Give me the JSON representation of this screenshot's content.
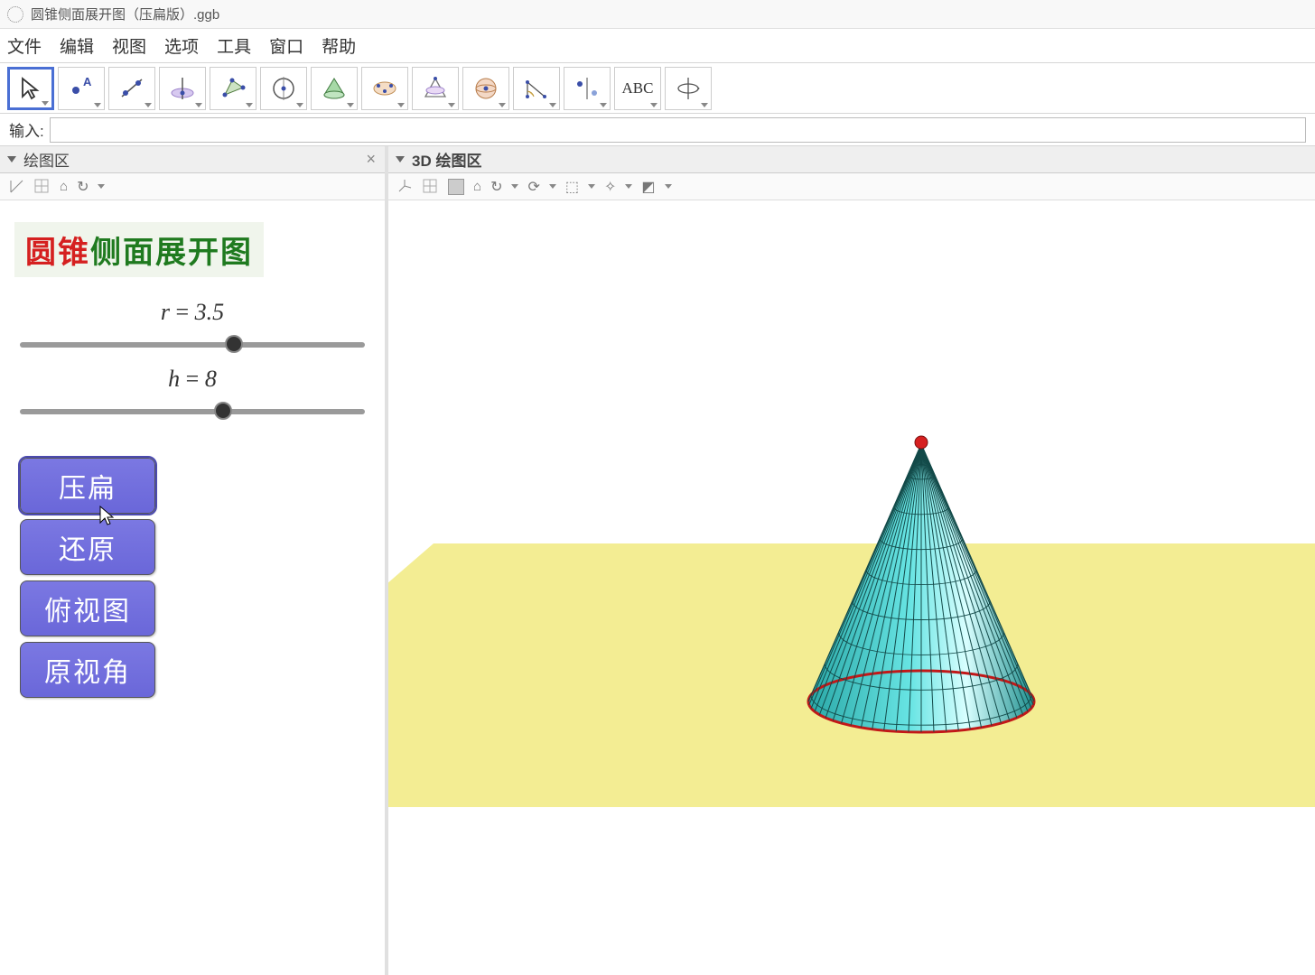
{
  "window": {
    "title": "圆锥侧面展开图（压扁版）.ggb"
  },
  "menu": {
    "file": "文件",
    "edit": "编辑",
    "view": "视图",
    "options": "选项",
    "tools": "工具",
    "window": "窗口",
    "help": "帮助"
  },
  "toolbar": {
    "move": "move-tool",
    "point": "point-tool",
    "line": "line-tool",
    "perp": "perpendicular-tool",
    "polygon": "polygon-tool",
    "circle": "circle-tool",
    "conic": "conic-tool",
    "locus": "locus-tool",
    "angle": "angle-tool",
    "sphere": "sphere-tool",
    "reflect": "reflect-tool",
    "slider": "slider-tool",
    "text": "text-tool",
    "rotate3d": "rotate3d-tool",
    "text_label": "ABC"
  },
  "input": {
    "label": "输入:",
    "value": ""
  },
  "panels": {
    "left": {
      "title": "绘图区"
    },
    "right": {
      "title": "3D 绘图区"
    }
  },
  "heading": {
    "part1": "圆锥",
    "part2": "侧面展开图"
  },
  "sliders": {
    "r": {
      "var": "r",
      "eq": "=",
      "value": "3.5",
      "percent": 62
    },
    "h": {
      "var": "h",
      "eq": "=",
      "value": "8",
      "percent": 59
    }
  },
  "buttons": {
    "flatten": "压扁",
    "restore": "还原",
    "top": "俯视图",
    "reset": "原视角"
  },
  "colors": {
    "cone_fill": "#3fd0cf",
    "cone_edge": "#134a49",
    "apex": "#d62020",
    "base_ring": "#c21818",
    "plane": "#f1ea80"
  }
}
